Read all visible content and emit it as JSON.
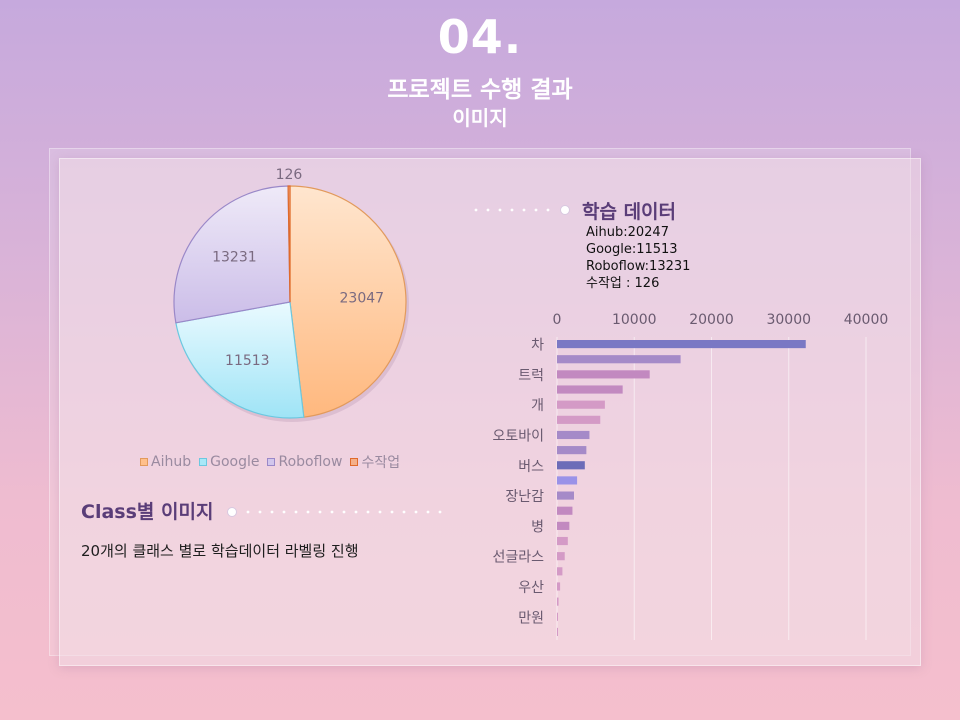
{
  "header": {
    "number": "04.",
    "title": "프로젝트 수행 결과",
    "subtitle": "이미지"
  },
  "colors": {
    "background_top": "#c6a9dd",
    "background_bottom": "#f5bfcd",
    "heading": "#5a3d78",
    "aihub": "#ffc08c",
    "google": "#a8e8f8",
    "roboflow": "#d2c6ec",
    "manual": "#e06a2a",
    "bar_palette": [
      "#7a78c4",
      "#a58ac8",
      "#c289c0",
      "#d49ac6",
      "#9a92e8",
      "#6c6cb8"
    ]
  },
  "training": {
    "title": "학습 데이터",
    "lines": [
      "Aihub:20247",
      "Google:11513",
      "Roboflow:13231",
      "수작업 : 126"
    ]
  },
  "class_section": {
    "title": "Class별 이미지",
    "description": "20개의 클래스 별로 학습데이터 라벨링 진행"
  },
  "chart_data": [
    {
      "type": "pie",
      "labels": [
        "Aihub",
        "Google",
        "Roboflow",
        "수작업"
      ],
      "values": [
        23047,
        11513,
        13231,
        126
      ],
      "legend_position": "bottom"
    },
    {
      "type": "bar",
      "orientation": "horizontal",
      "axis_ticks": [
        "0",
        "10000",
        "20000",
        "30000",
        "40000"
      ],
      "xlim": [
        0,
        40000
      ],
      "category_labels": [
        "차",
        "트럭",
        "개",
        "오토바이",
        "버스",
        "장난감",
        "병",
        "선글라스",
        "우산",
        "만원"
      ],
      "values": [
        32200,
        16000,
        12000,
        8500,
        6200,
        5600,
        4200,
        3800,
        3600,
        2600,
        2200,
        2000,
        1600,
        1400,
        1000,
        700,
        400,
        200,
        100,
        50
      ],
      "grid": true
    }
  ]
}
